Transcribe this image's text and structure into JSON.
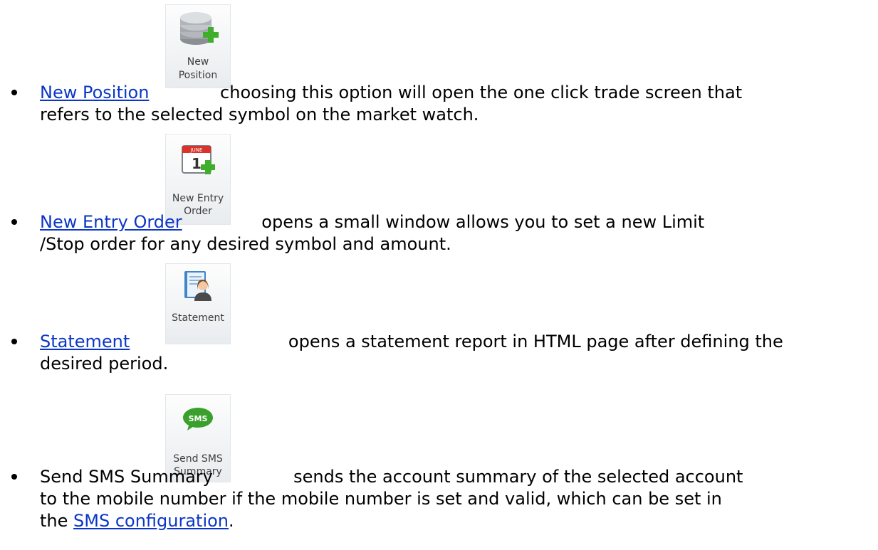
{
  "items": [
    {
      "link": "New Position",
      "text1": " choosing this option will open the one click trade screen that",
      "text2": "refers to the selected symbol on the market watch.",
      "button": {
        "line1": "New",
        "line2": "Position",
        "icon": "database-add-icon"
      }
    },
    {
      "link": "New Entry Order",
      "text1": " opens a small window allows you to set a new Limit",
      "text2": "/Stop order for any desired symbol and amount.",
      "button": {
        "line1": "New Entry",
        "line2": "Order",
        "icon": "calendar-add-icon",
        "calendar_month": "JUNE",
        "calendar_day": "1"
      }
    },
    {
      "link": "Statement",
      "text1": " opens a statement report in HTML page after defining the",
      "text2": "desired period.",
      "button": {
        "line1": "Statement",
        "line2": "",
        "icon": "address-book-icon"
      }
    },
    {
      "text0": "Send SMS Summary ",
      "text1": " sends the account summary of the selected account",
      "text2": "to the mobile number if the mobile number is set and valid, which can be set in",
      "text3_prefix": "the ",
      "text3_link": "SMS configuration",
      "text3_suffix": ".",
      "button": {
        "line1": "Send SMS",
        "line2": "Summary",
        "icon": "sms-bubble-icon",
        "badge": "SMS"
      }
    }
  ],
  "colors": {
    "link": "#0b36c6",
    "button_bg": "#eceef1",
    "green_plus": "#3fae2a"
  }
}
